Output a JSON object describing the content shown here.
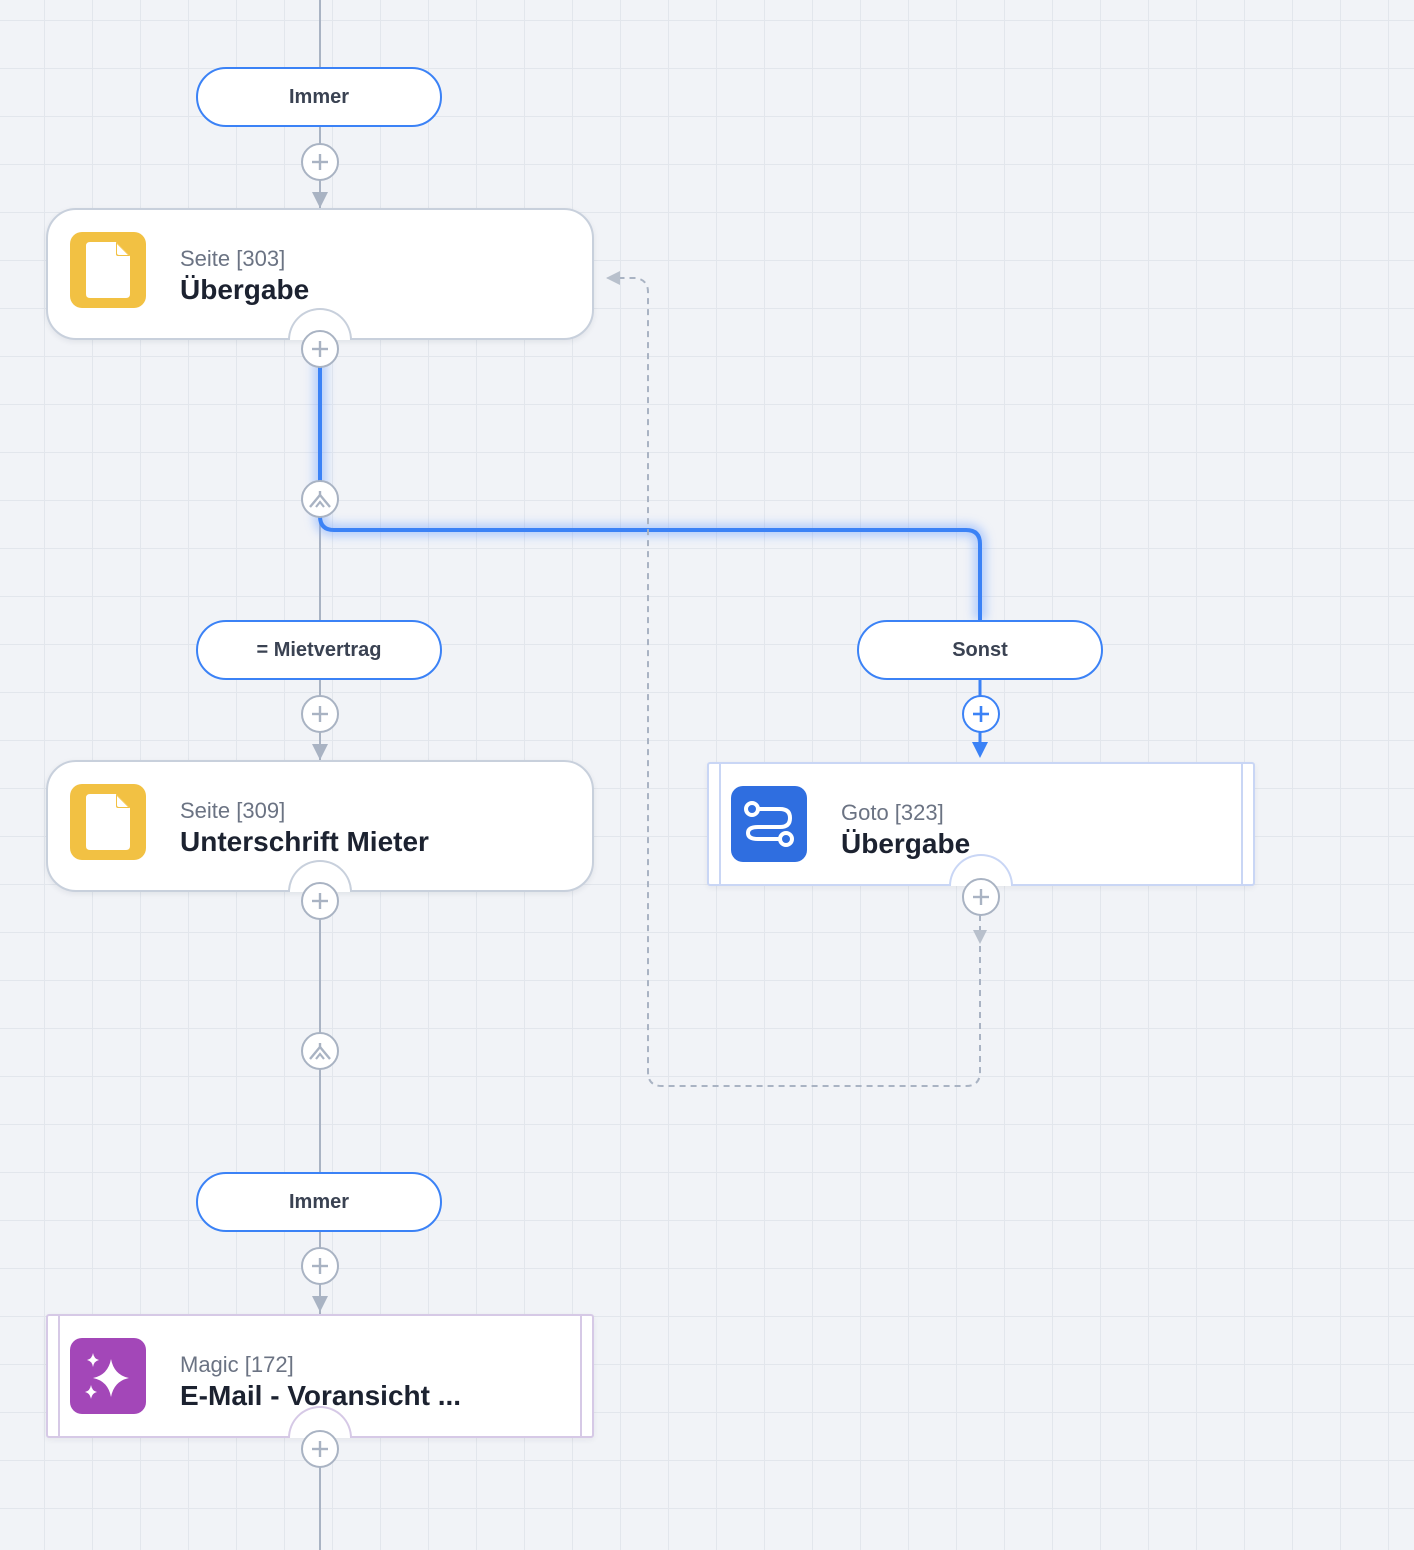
{
  "colors": {
    "accent": "#3b82f6",
    "connector": "#a9b3c3",
    "page_icon": "#f2c143",
    "goto_icon": "#2f6ee0",
    "magic_icon": "#a347b8"
  },
  "conditions": {
    "top": {
      "label": "Immer"
    },
    "mietvertrag": {
      "label": "= Mietvertrag"
    },
    "sonst": {
      "label": "Sonst"
    },
    "bottom": {
      "label": "Immer"
    }
  },
  "nodes": {
    "page303": {
      "subtitle": "Seite [303]",
      "title": "Übergabe",
      "icon": "page-icon"
    },
    "page309": {
      "subtitle": "Seite [309]",
      "title": "Unterschrift Mieter",
      "icon": "page-icon"
    },
    "goto323": {
      "subtitle": "Goto [323]",
      "title": "Übergabe",
      "icon": "route-icon"
    },
    "magic172": {
      "subtitle": "Magic [172]",
      "title": "E-Mail - Voransicht ...",
      "icon": "sparkle-icon"
    }
  }
}
